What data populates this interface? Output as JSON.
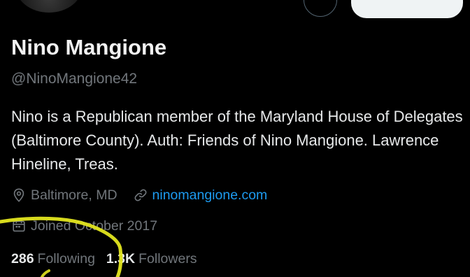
{
  "profile": {
    "display_name": "Nino Mangione",
    "handle": "@NinoMangione42",
    "bio": "Nino is a Republican member of the Maryland House of Delegates (Baltimore County). Auth: Friends of Nino Mangione. Lawrence Hineline, Treas.",
    "location": "Baltimore, MD",
    "website": "ninomangione.com",
    "joined": "Joined October 2017",
    "following_count": "286",
    "following_label": "Following",
    "followers_count": "1.3K",
    "followers_label": "Followers"
  },
  "icons": {
    "location": "location-pin-icon",
    "link": "link-icon",
    "calendar": "calendar-icon"
  },
  "colors": {
    "background": "#000000",
    "primary_text": "#e7e9ea",
    "secondary_text": "#71767b",
    "link": "#1d9bf0",
    "annotation_marker": "#e3e61f",
    "follow_button": "#eff3f4"
  }
}
